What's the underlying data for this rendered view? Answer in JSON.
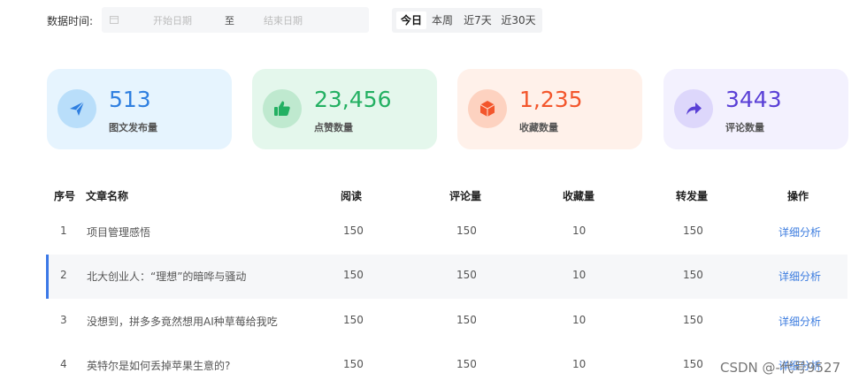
{
  "filter": {
    "label": "数据时间:",
    "start_placeholder": "开始日期",
    "separator": "至",
    "end_placeholder": "结束日期",
    "quick": [
      "今日",
      "本周",
      "近7天",
      "近30天"
    ],
    "active": "今日"
  },
  "cards": [
    {
      "value": "513",
      "label": "图文发布量",
      "icon": "paper-plane-icon",
      "bg": "#e6f4fe",
      "icon_bg": "#b9defa",
      "accent": "#2f7fe0"
    },
    {
      "value": "23,456",
      "label": "点赞数量",
      "icon": "thumbs-up-icon",
      "bg": "#e4f7ec",
      "icon_bg": "#bfe9cf",
      "accent": "#23b062"
    },
    {
      "value": "1,235",
      "label": "收藏数量",
      "icon": "cube-icon",
      "bg": "#fff1ea",
      "icon_bg": "#fdd2c0",
      "accent": "#f3562c"
    },
    {
      "value": "3443",
      "label": "评论数量",
      "icon": "share-arrow-icon",
      "bg": "#f3f1fe",
      "icon_bg": "#ddd7fb",
      "accent": "#5a40d6"
    }
  ],
  "table": {
    "headers": [
      "序号",
      "文章名称",
      "阅读",
      "评论量",
      "收藏量",
      "转发量",
      "操作"
    ],
    "rows": [
      {
        "no": "1",
        "title": "项目管理感悟",
        "read": "150",
        "comment": "150",
        "fav": "10",
        "share": "150",
        "action": "详细分析"
      },
      {
        "no": "2",
        "title": "北大创业人：“理想”的暗哗与骚动",
        "read": "150",
        "comment": "150",
        "fav": "10",
        "share": "150",
        "action": "详细分析"
      },
      {
        "no": "3",
        "title": "没想到，拼多多竟然想用AI种草莓给我吃",
        "read": "150",
        "comment": "150",
        "fav": "10",
        "share": "150",
        "action": "详细分析"
      },
      {
        "no": "4",
        "title": "英特尔是如何丢掉苹果生意的?",
        "read": "150",
        "comment": "150",
        "fav": "10",
        "share": "150",
        "action": "详细分析"
      }
    ]
  },
  "watermark": "CSDN @-代号9527"
}
